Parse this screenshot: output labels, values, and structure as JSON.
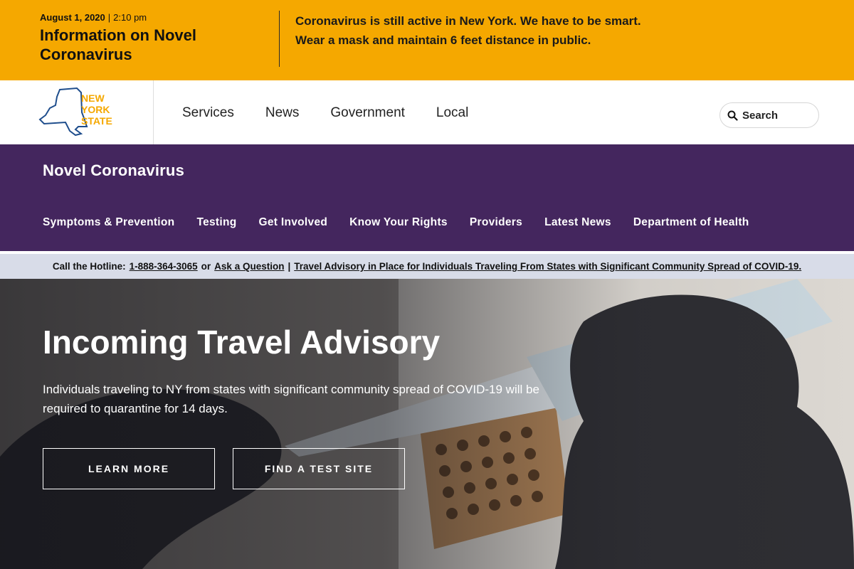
{
  "alert": {
    "date": "August 1, 2020",
    "separator": "|",
    "time": "2:10 pm",
    "title": "Information on Novel Coronavirus",
    "message_line1": "Coronavirus is still active in New York. We have to be smart.",
    "message_line2": "Wear a mask and maintain 6 feet distance in public.",
    "background_color": "#f5a800"
  },
  "header": {
    "logo_text": [
      "NEW",
      "YORK",
      "STATE"
    ],
    "nav": [
      "Services",
      "News",
      "Government",
      "Local"
    ],
    "search_placeholder": "Search"
  },
  "section": {
    "title": "Novel Coronavirus",
    "background_color": "#44265e",
    "sub_nav": [
      "Symptoms & Prevention",
      "Testing",
      "Get Involved",
      "Know Your Rights",
      "Providers",
      "Latest News",
      "Department of Health"
    ]
  },
  "hotline": {
    "prefix": "Call the Hotline:",
    "phone": "1-888-364-3065",
    "or": "or",
    "ask": "Ask a Question",
    "divider": "|",
    "advisory": "Travel Advisory in Place for Individuals Traveling From States with Significant Community Spread of COVID-19."
  },
  "hero": {
    "title": "Incoming Travel Advisory",
    "text": "Individuals traveling to NY from states with significant community spread of COVID-19 will be required to quarantine for 14 days.",
    "buttons": [
      "LEARN MORE",
      "FIND A TEST SITE"
    ]
  }
}
